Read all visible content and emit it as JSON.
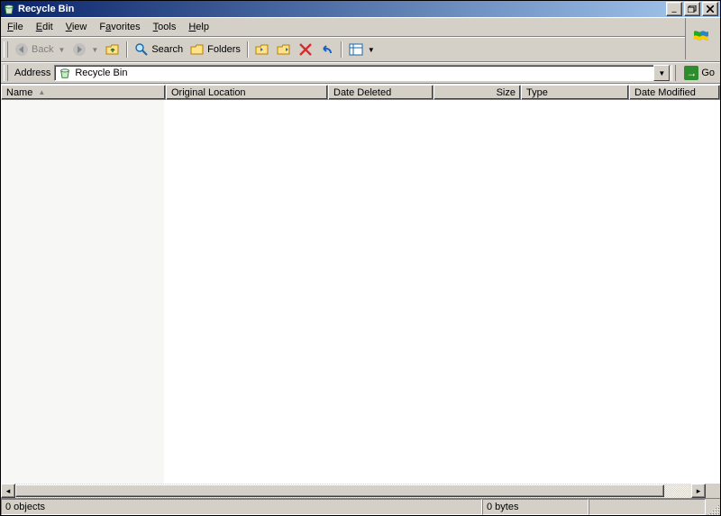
{
  "window": {
    "title": "Recycle Bin"
  },
  "menu": {
    "file": {
      "u": "F",
      "rest": "ile"
    },
    "edit": {
      "u": "E",
      "rest": "dit"
    },
    "view": {
      "u": "V",
      "rest": "iew"
    },
    "favorites": {
      "u": "a",
      "pre": "F",
      "rest": "vorites"
    },
    "tools": {
      "u": "T",
      "rest": "ools"
    },
    "help": {
      "u": "H",
      "rest": "elp"
    }
  },
  "toolbar": {
    "back": "Back",
    "search": "Search",
    "folders": "Folders"
  },
  "address": {
    "label": "Address",
    "value": "Recycle Bin",
    "go": "Go"
  },
  "columns": {
    "name": "Name",
    "origloc": "Original Location",
    "deleted": "Date Deleted",
    "size": "Size",
    "type": "Type",
    "modified": "Date Modified"
  },
  "status": {
    "objects": "0 objects",
    "bytes": "0 bytes"
  }
}
